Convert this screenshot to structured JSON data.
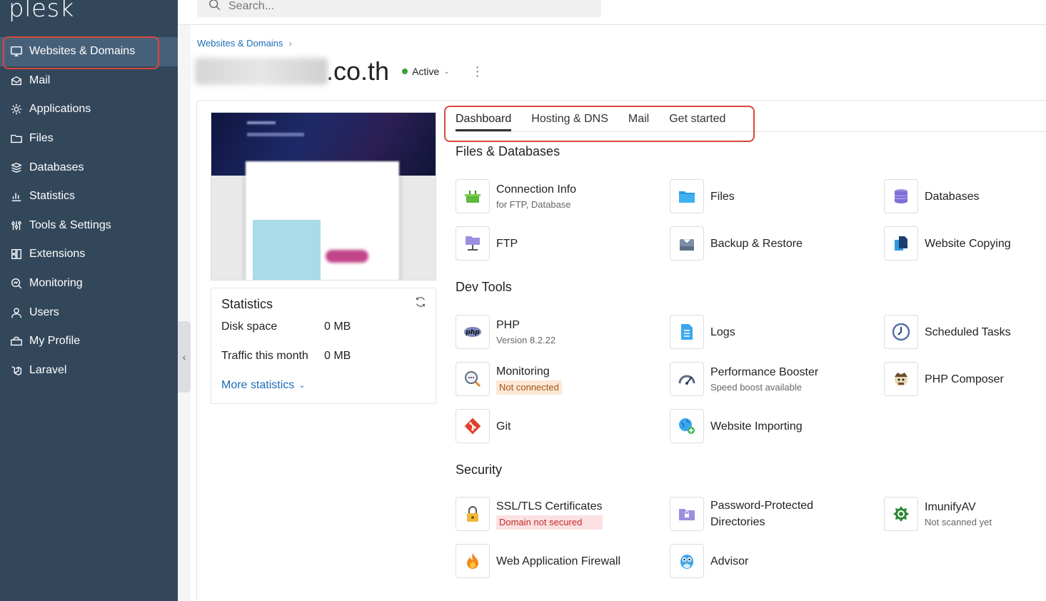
{
  "app": {
    "logo": "plesk"
  },
  "sidebar": {
    "items": [
      {
        "label": "Websites & Domains",
        "icon": "monitor-icon",
        "active": true
      },
      {
        "label": "Mail",
        "icon": "mail-icon"
      },
      {
        "label": "Applications",
        "icon": "gear-icon"
      },
      {
        "label": "Files",
        "icon": "folder-icon"
      },
      {
        "label": "Databases",
        "icon": "database-icon"
      },
      {
        "label": "Statistics",
        "icon": "bar-chart-icon"
      },
      {
        "label": "Tools & Settings",
        "icon": "sliders-icon"
      },
      {
        "label": "Extensions",
        "icon": "extensions-icon"
      },
      {
        "label": "Monitoring",
        "icon": "monitoring-icon"
      },
      {
        "label": "Users",
        "icon": "user-icon"
      },
      {
        "label": "My Profile",
        "icon": "profile-icon"
      },
      {
        "label": "Laravel",
        "icon": "laravel-icon"
      }
    ]
  },
  "search": {
    "placeholder": "Search..."
  },
  "breadcrumb": {
    "item": "Websites & Domains"
  },
  "domain": {
    "visible_suffix": ".co.th",
    "status": "Active"
  },
  "statistics": {
    "title": "Statistics",
    "disk_label": "Disk space",
    "disk_value": "0 MB",
    "traffic_label": "Traffic this month",
    "traffic_value": "0 MB",
    "more": "More statistics"
  },
  "tabs": [
    "Dashboard",
    "Hosting & DNS",
    "Mail",
    "Get started"
  ],
  "sections": {
    "files_db": "Files & Databases",
    "dev": "Dev Tools",
    "security": "Security"
  },
  "tiles": {
    "connection_info": {
      "title": "Connection Info",
      "sub": "for FTP, Database"
    },
    "files": {
      "title": "Files"
    },
    "databases": {
      "title": "Databases"
    },
    "ftp": {
      "title": "FTP"
    },
    "backup": {
      "title": "Backup & Restore"
    },
    "website_copying": {
      "title": "Website Copying"
    },
    "php": {
      "title": "PHP",
      "sub": "Version 8.2.22"
    },
    "logs": {
      "title": "Logs"
    },
    "scheduled": {
      "title": "Scheduled Tasks"
    },
    "monitoring": {
      "title": "Monitoring",
      "badge": "Not connected"
    },
    "perf": {
      "title": "Performance Booster",
      "sub": "Speed boost available"
    },
    "composer": {
      "title": "PHP Composer"
    },
    "git": {
      "title": "Git"
    },
    "importing": {
      "title": "Website Importing"
    },
    "ssl": {
      "title": "SSL/TLS Certificates",
      "badge": "Domain not secured"
    },
    "pwdirs": {
      "title": "Password-Protected",
      "title2": "Directories"
    },
    "imunify": {
      "title": "ImunifyAV",
      "sub": "Not scanned yet"
    },
    "waf": {
      "title": "Web Application Firewall"
    },
    "advisor": {
      "title": "Advisor"
    }
  },
  "colors": {
    "sidebar_bg": "#33475b",
    "accent_blue": "#1a6eb8",
    "highlight_red": "#d9483b"
  }
}
